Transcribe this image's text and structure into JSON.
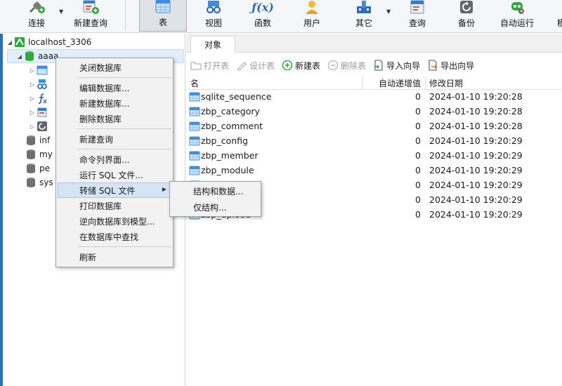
{
  "toolbar": {
    "connect": "连接",
    "new_query": "新建查询",
    "table": "表",
    "view": "视图",
    "function": "函数",
    "user": "用户",
    "other": "其它",
    "query": "查询",
    "backup": "备份",
    "autorun": "自动运行",
    "cut_label": "模",
    "function_glyph": "ƒ(x)"
  },
  "tree": {
    "connection": "localhost_3306",
    "database": "aaaa",
    "dbs": [
      {
        "label": "inf"
      },
      {
        "label": "my"
      },
      {
        "label": "pe"
      },
      {
        "label": "sys"
      }
    ]
  },
  "tabs": {
    "objects": "对象"
  },
  "object_toolbar": {
    "open_table": "打开表",
    "design_table": "设计表",
    "new_table": "新建表",
    "delete_table": "删除表",
    "import_wizard": "导入向导",
    "export_wizard": "导出向导"
  },
  "grid": {
    "headers": {
      "name": "名",
      "auto_increment": "自动递增值",
      "modified": "修改日期"
    },
    "rows": [
      {
        "name": "sqlite_sequence",
        "auto_inc": "0",
        "modified": "2024-01-10 19:20:28"
      },
      {
        "name": "zbp_category",
        "auto_inc": "0",
        "modified": "2024-01-10 19:20:28"
      },
      {
        "name": "zbp_comment",
        "auto_inc": "0",
        "modified": "2024-01-10 19:20:28"
      },
      {
        "name": "zbp_config",
        "auto_inc": "0",
        "modified": "2024-01-10 19:20:29"
      },
      {
        "name": "zbp_member",
        "auto_inc": "0",
        "modified": "2024-01-10 19:20:29"
      },
      {
        "name": "zbp_module",
        "auto_inc": "0",
        "modified": "2024-01-10 19:20:29"
      },
      {
        "name": "",
        "auto_inc": "0",
        "modified": "2024-01-10 19:20:29"
      },
      {
        "name": "",
        "auto_inc": "0",
        "modified": "2024-01-10 19:20:29"
      },
      {
        "name": "zbp_upload",
        "auto_inc": "0",
        "modified": "2024-01-10 19:20:29"
      }
    ]
  },
  "context_menu": {
    "close_db": "关闭数据库",
    "edit_db": "编辑数据库...",
    "new_db": "新建数据库...",
    "delete_db": "删除数据库",
    "new_query": "新建查询",
    "console": "命令列界面...",
    "run_sql": "运行 SQL 文件...",
    "dump_sql": "转储 SQL 文件",
    "print_db": "打印数据库",
    "reverse_model": "逆向数据库到模型...",
    "find_in_db": "在数据库中查找",
    "refresh": "刷新"
  },
  "submenu": {
    "structure_data": "结构和数据...",
    "structure_only": "仅结构..."
  },
  "colors": {
    "accent_blue": "#2f80d1",
    "green": "#2eaa3c",
    "menu_hover": "#d5e4f5"
  }
}
